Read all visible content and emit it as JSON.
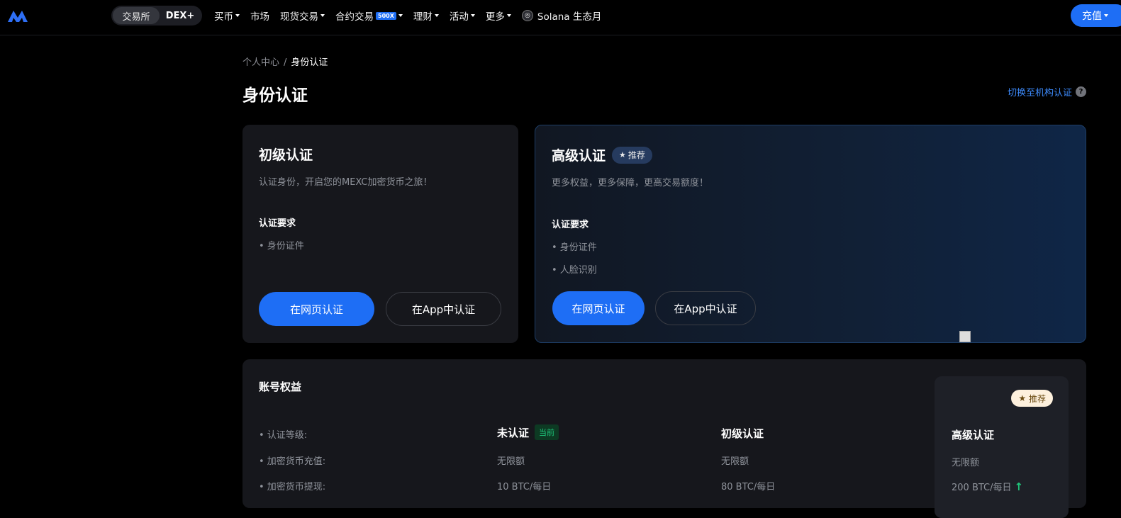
{
  "nav": {
    "switch": [
      "交易所",
      "DEX+"
    ],
    "menu": [
      {
        "label": "买币",
        "caret": true
      },
      {
        "label": "市场",
        "caret": false
      },
      {
        "label": "现货交易",
        "caret": true
      },
      {
        "label": "合约交易",
        "caret": true,
        "badge": "500X"
      },
      {
        "label": "理财",
        "caret": true
      },
      {
        "label": "活动",
        "caret": true
      },
      {
        "label": "更多",
        "caret": true
      }
    ],
    "solana": "Solana 生态月",
    "deposit": "充值"
  },
  "breadcrumb": {
    "parent": "个人中心",
    "sep": "/",
    "current": "身份认证"
  },
  "page_title": "身份认证",
  "switch_institution": "切换至机构认证",
  "help_glyph": "?",
  "basic": {
    "title": "初级认证",
    "desc": "认证身份，开启您的MEXC加密货币之旅！",
    "req_title": "认证要求",
    "reqs": [
      "• 身份证件"
    ],
    "btn_web": "在网页认证",
    "btn_app": "在App中认证"
  },
  "advanced": {
    "title": "高级认证",
    "tag": "推荐",
    "desc": "更多权益，更多保障，更高交易额度！",
    "req_title": "认证要求",
    "reqs": [
      "• 身份证件",
      "• 人脸识别"
    ],
    "btn_web": "在网页认证",
    "btn_app": "在App中认证"
  },
  "benefits": {
    "title": "账号权益",
    "labels": [
      "• 认证等级:",
      "• 加密货币充值:",
      "• 加密货币提现:"
    ],
    "unverified": {
      "head": "未认证",
      "tag": "当前",
      "values": [
        "无限额",
        "10 BTC/每日"
      ]
    },
    "basic": {
      "head": "初级认证",
      "values": [
        "无限额",
        "80 BTC/每日"
      ]
    },
    "advanced": {
      "tag": "推荐",
      "head": "高级认证",
      "values": [
        "无限额",
        "200 BTC/每日"
      ]
    }
  },
  "colors": {
    "accent": "#1e6ef5",
    "link": "#3d8bfd",
    "success": "#1fc47a"
  }
}
